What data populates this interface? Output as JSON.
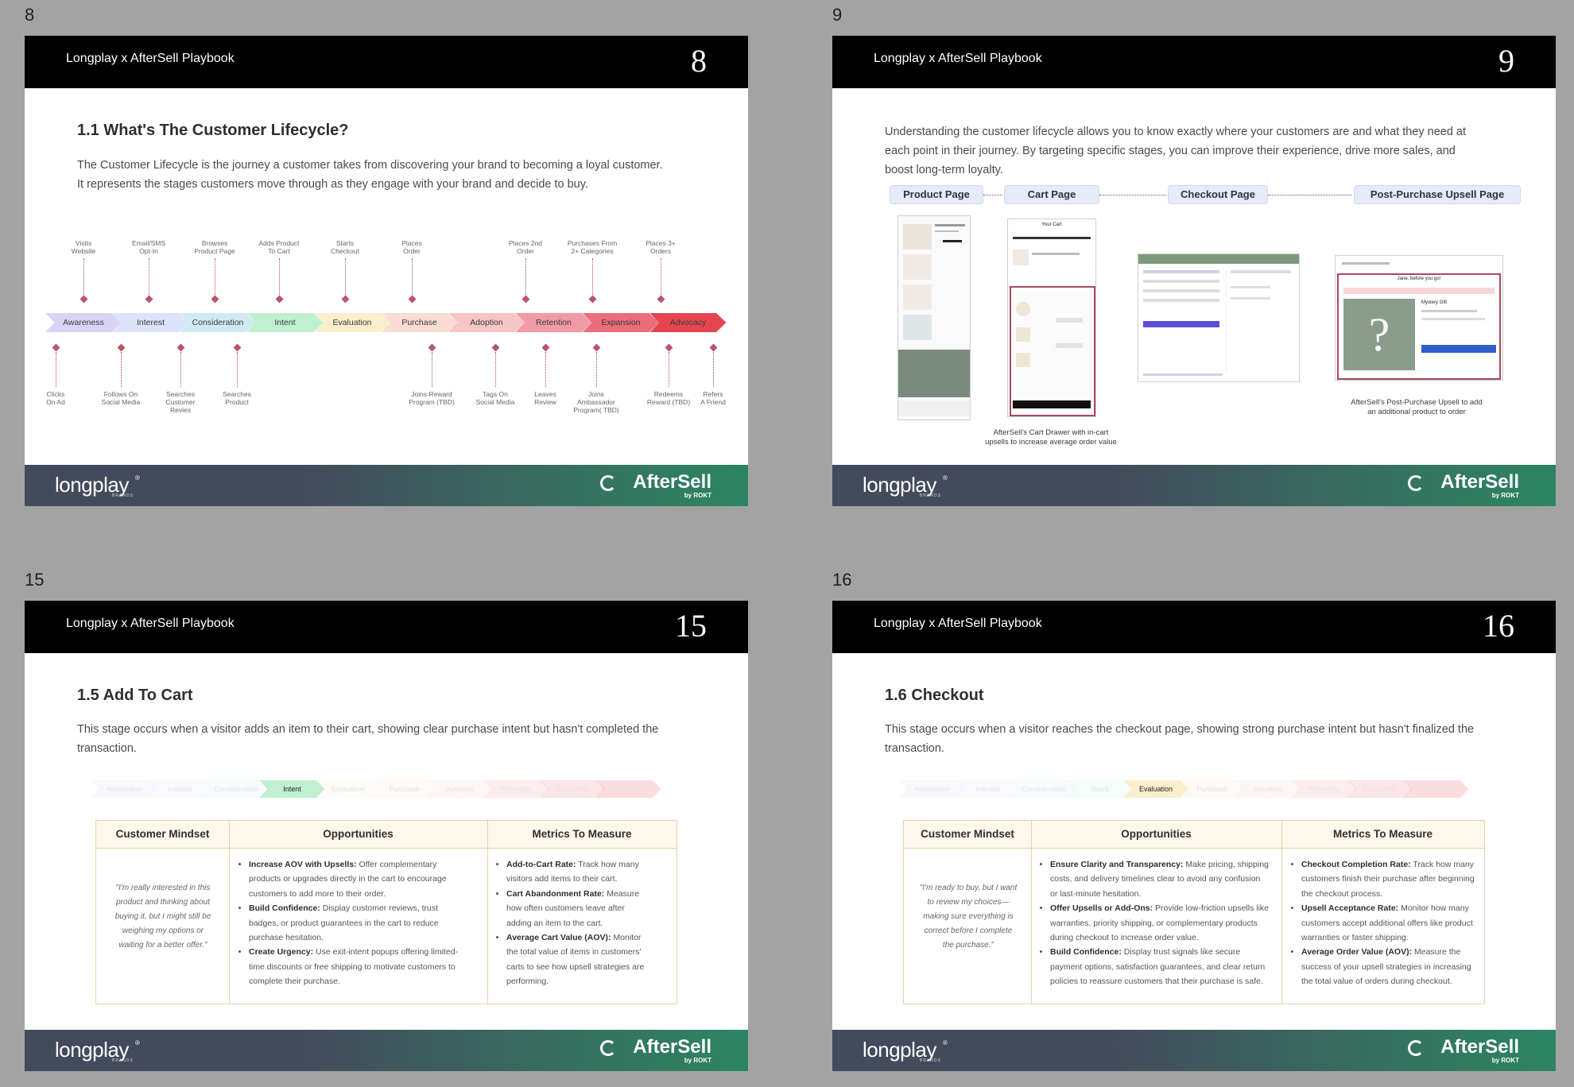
{
  "pages": [
    {
      "number": "8"
    },
    {
      "number": "9"
    },
    {
      "number": "15"
    },
    {
      "number": "16"
    }
  ],
  "slide_header": "Longplay x AfterSell Playbook",
  "footer": {
    "longplay": "longplay",
    "longplay_mark": "®",
    "longplay_sub": "BRANDS",
    "aftersell": "AfterSell",
    "aftersell_by": "by ROKT"
  },
  "slide8": {
    "title": "1.1 What's The Customer Lifecycle?",
    "para1": "The Customer Lifecycle is the journey a customer takes from discovering your brand to becoming a loyal customer.",
    "para2": "It represents the stages customers move through as they engage with your brand and decide to buy.",
    "stages": [
      "Awareness",
      "Interest",
      "Consideration",
      "Intent",
      "Evaluation",
      "Purchase",
      "Adoption",
      "Retention",
      "Expansion",
      "Advocacy"
    ],
    "stage_colors": [
      "#d9d4f5",
      "#dce4fb",
      "#cfeaf3",
      "#bff0cf",
      "#faeecd",
      "#fadcd2",
      "#f6c5c5",
      "#f09ba5",
      "#ea6d7a",
      "#e54550"
    ],
    "top_annotations": [
      {
        "l1": "Visits",
        "l2": "Website"
      },
      {
        "l1": "Email/SMS",
        "l2": "Opt-In"
      },
      {
        "l1": "Browses",
        "l2": "Product Page"
      },
      {
        "l1": "Adds Product",
        "l2": "To Cart"
      },
      {
        "l1": "Starts",
        "l2": "Checkout"
      },
      {
        "l1": "Places",
        "l2": "Order"
      },
      {
        "l1": "Places 2nd",
        "l2": "Order"
      },
      {
        "l1": "Purchases From",
        "l2": "2+ Categories"
      },
      {
        "l1": "Places 3+",
        "l2": "Orders"
      }
    ],
    "bottom_annotations": [
      {
        "l1": "Clicks",
        "l2": "On Ad",
        "l3": ""
      },
      {
        "l1": "Follows On",
        "l2": "Social Media",
        "l3": ""
      },
      {
        "l1": "Searches",
        "l2": "Customer",
        "l3": "Revies"
      },
      {
        "l1": "Searches",
        "l2": "Product",
        "l3": ""
      },
      {
        "l1": "Joins Reward",
        "l2": "Program (TBD)",
        "l3": ""
      },
      {
        "l1": "Tags On",
        "l2": "Social Media",
        "l3": ""
      },
      {
        "l1": "Leaves",
        "l2": "Review",
        "l3": ""
      },
      {
        "l1": "Joins",
        "l2": "Ambassador",
        "l3": "Program( TBD)"
      },
      {
        "l1": "Redeems",
        "l2": "Reward (TBD)",
        "l3": ""
      },
      {
        "l1": "Refers",
        "l2": "A Friend",
        "l3": ""
      }
    ]
  },
  "slide9": {
    "para1": "Understanding the customer lifecycle allows you to know exactly where your customers are and what they need at",
    "para2": "each point in their journey. By targeting specific stages, you can improve their experience, drive more sales, and",
    "para3": "boost long-term loyalty.",
    "steps": [
      "Product Page",
      "Cart Page",
      "Checkout Page",
      "Post-Purchase Upsell Page"
    ],
    "cart_title": "Your Cart",
    "cart_caption_1": "AfterSell's Cart Drawer with in-cart",
    "cart_caption_2": "upsells to increase average order value",
    "pp_title": "Jane, before you go!",
    "pp_item": "Mystery Gift",
    "pp_question": "?",
    "pp_caption_1": "AfterSell's Post-Purchase Upsell to add",
    "pp_caption_2": "an additional product to order"
  },
  "slide15": {
    "title": "1.5 Add To Cart",
    "para1": "This stage occurs when a visitor adds an item to their cart, showing clear purchase intent but hasn't completed the",
    "para2": "transaction.",
    "active_stage": "Intent",
    "table": {
      "headers": [
        "Customer Mindset",
        "Opportunities",
        "Metrics To Measure"
      ],
      "quote_lines": [
        "\"I'm really interested in this",
        "product and thinking about",
        "buying it, but I might still be",
        "weighing my options or",
        "waiting for a better offer.\""
      ],
      "opportunities": [
        {
          "bold": "Increase AOV with Upsells:",
          "l1": " Offer complementary",
          "l2": "products or upgrades directly in the cart to encourage",
          "l3": "customers to add more to their order."
        },
        {
          "bold": "Build Confidence:",
          "l1": " Display customer reviews, trust",
          "l2": "badges, or product guarantees in the cart to reduce",
          "l3": "purchase hesitation."
        },
        {
          "bold": "Create Urgency:",
          "l1": " Use exit-intent popups offering limited-",
          "l2": "time discounts or free shipping to motivate customers to",
          "l3": "complete their purchase."
        }
      ],
      "metrics": [
        {
          "bold": "Add-to-Cart Rate:",
          "l1": " Track how many",
          "l2": "visitors add items to their cart.",
          "l3": ""
        },
        {
          "bold": "Cart Abandonment Rate:",
          "l1": " Measure",
          "l2": "how often customers leave after",
          "l3": "adding an item to the cart."
        },
        {
          "bold": "Average Cart Value (AOV):",
          "l1": " Monitor",
          "l2": "the total value of items in customers'",
          "l3": "carts to see how upsell strategies are",
          "l4": "performing."
        }
      ]
    }
  },
  "slide16": {
    "title": "1.6 Checkout",
    "para1": "This stage occurs when a visitor reaches the checkout page, showing strong purchase intent but hasn't finalized the",
    "para2": "transaction.",
    "active_stage": "Evaluation",
    "table": {
      "headers": [
        "Customer Mindset",
        "Opportunities",
        "Metrics To Measure"
      ],
      "quote_lines": [
        "\"I'm ready to buy, but I want",
        "to review my choices—",
        "making sure everything is",
        "correct before I complete",
        "the purchase.\""
      ],
      "opportunities": [
        {
          "bold": "Ensure Clarity and Transparency:",
          "l1": " Make pricing, shipping",
          "l2": "costs, and delivery timelines clear to avoid any confusion",
          "l3": "or last-minute hesitation."
        },
        {
          "bold": "Offer Upsells or Add-Ons:",
          "l1": " Provide low-friction upsells like",
          "l2": "warranties, priority shipping, or complementary products",
          "l3": "during checkout to increase order value."
        },
        {
          "bold": "Build Confidence:",
          "l1": " Display trust signals like secure",
          "l2": "payment options, satisfaction guarantees, and clear return",
          "l3": "policies to reassure customers that their purchase is safe."
        }
      ],
      "metrics": [
        {
          "bold": "Checkout Completion Rate:",
          "l1": " Track how many",
          "l2": "customers finish their purchase after beginning",
          "l3": "the checkout process."
        },
        {
          "bold": "Upsell Acceptance Rate:",
          "l1": " Monitor how many",
          "l2": "customers accept additional offers like product",
          "l3": "warranties or faster shipping."
        },
        {
          "bold": "Average Order Value (AOV):",
          "l1": " Measure the",
          "l2": "success of your upsell strategies in increasing",
          "l3": "the total value of orders during checkout."
        }
      ]
    }
  }
}
